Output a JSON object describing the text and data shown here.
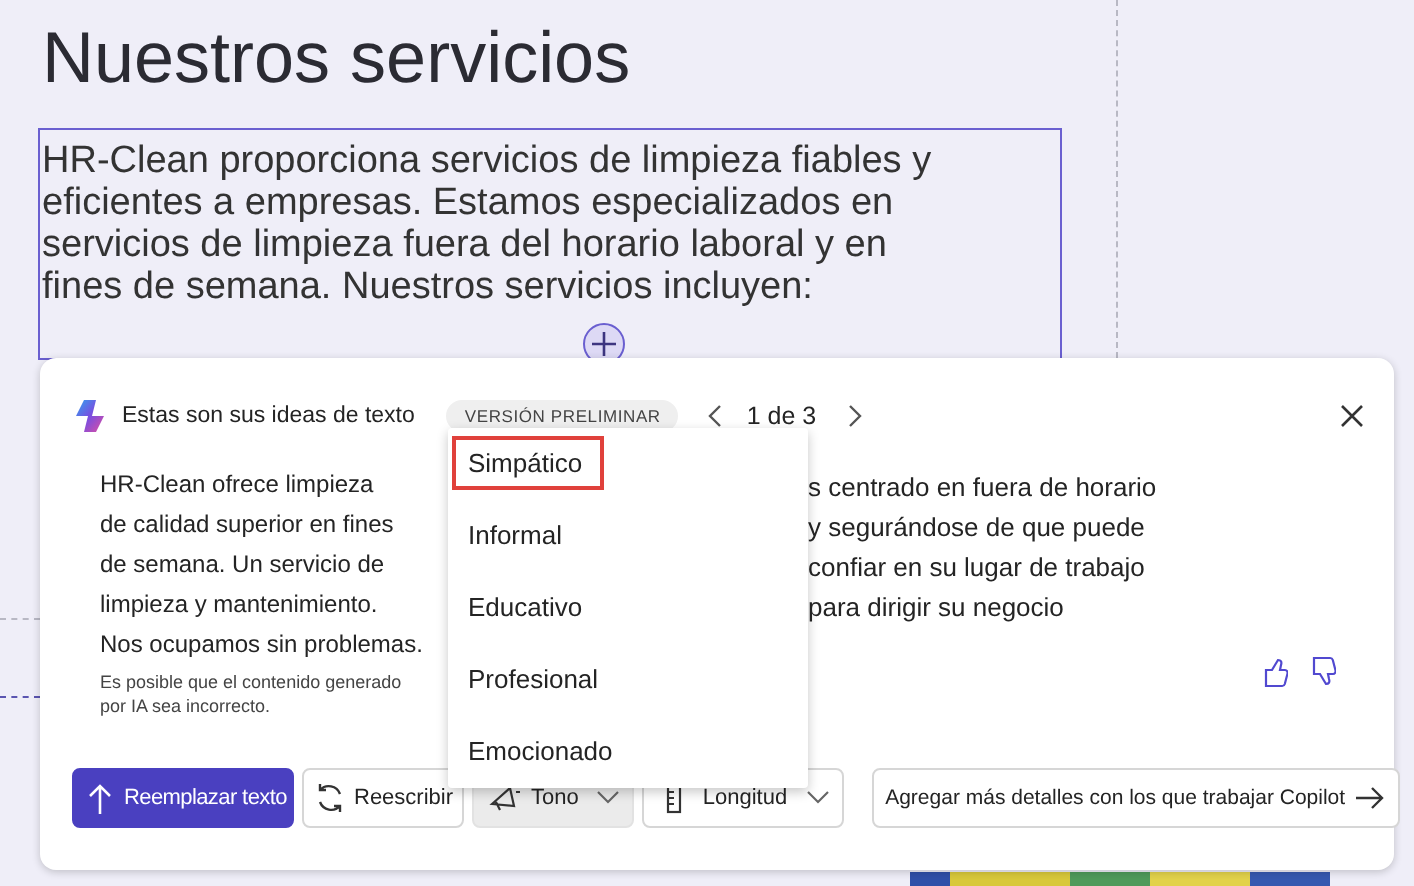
{
  "document": {
    "heading": "Nuestros servicios",
    "paragraph": "HR-Clean proporciona servicios de limpieza fiables y eficientes a empresas. Estamos especializados en servicios de limpieza fuera del horario laboral y en fines de semana. Nuestros servicios incluyen:"
  },
  "panel": {
    "title": "Estas son sus ideas de texto",
    "badge": "VERSIÓN PRELIMINAR",
    "pager": "1 de 3",
    "suggestions": [
      {
        "lines": [
          "HR-Clean ofrece limpieza",
          "de calidad superior en fines",
          "de semana. Un servicio de",
          "limpieza y mantenimiento.",
          "Nos ocupamos sin problemas."
        ],
        "disclaimer": "Es posible que el contenido generado por IA sea incorrecto."
      },
      {
        "lines": [
          "s centrado en fuera de horario",
          "y segurándose de que puede",
          "confiar en su lugar de trabajo",
          "para dirigir su negocio"
        ]
      }
    ],
    "actions": [
      {
        "kind": "primary",
        "label": "Reemplazar texto"
      },
      {
        "kind": "plain",
        "label": "Reescribir"
      },
      {
        "kind": "dropdown",
        "label": "Tono",
        "expanded": true
      },
      {
        "kind": "dropdown",
        "label": "Longitud",
        "expanded": false
      }
    ],
    "details_button": "Agregar más detalles con los que trabajar Copilot",
    "tone_menu": [
      {
        "label": "Simpático",
        "selected": true
      },
      {
        "label": "Informal",
        "selected": false
      },
      {
        "label": "Educativo",
        "selected": false
      },
      {
        "label": "Profesional",
        "selected": false
      },
      {
        "label": "Emocionado",
        "selected": false
      }
    ]
  }
}
